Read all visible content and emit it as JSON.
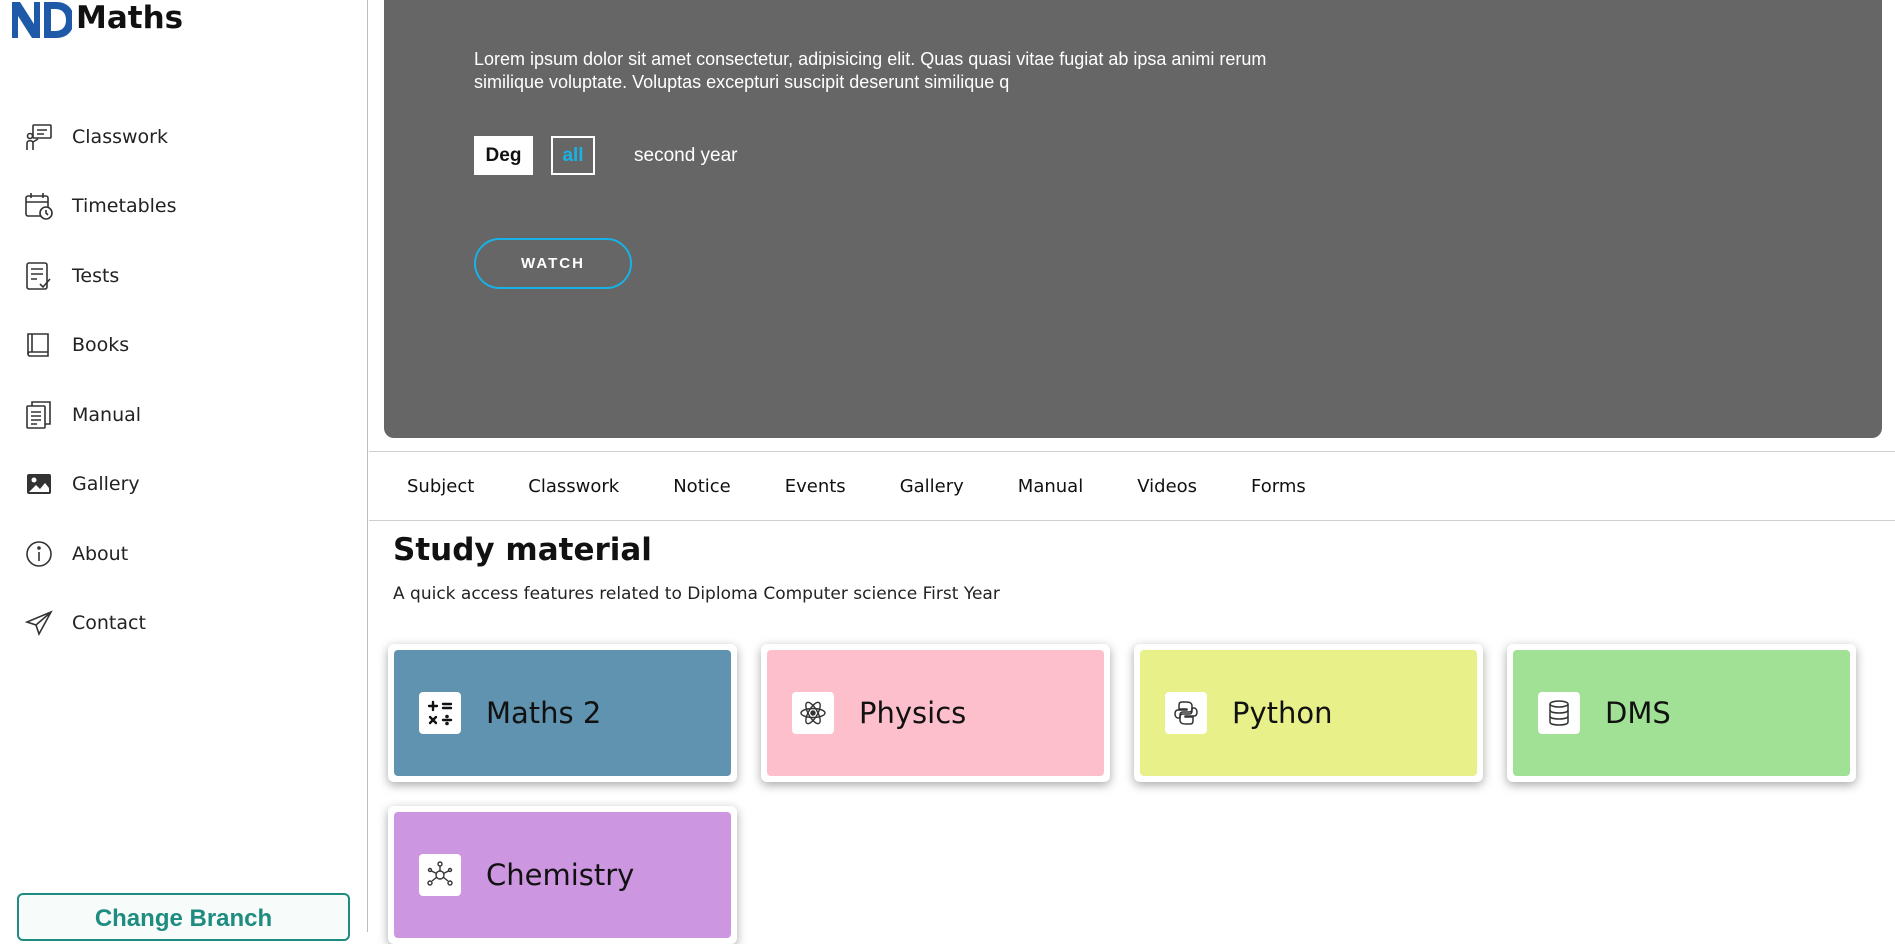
{
  "app": {
    "logo_text": "Maths"
  },
  "sidebar": {
    "items": [
      {
        "label": "Classwork",
        "icon": "classwork-icon"
      },
      {
        "label": "Timetables",
        "icon": "calendar-clock-icon"
      },
      {
        "label": "Tests",
        "icon": "test-checklist-icon"
      },
      {
        "label": "Books",
        "icon": "book-icon"
      },
      {
        "label": "Manual",
        "icon": "manual-document-icon"
      },
      {
        "label": "Gallery",
        "icon": "image-icon"
      },
      {
        "label": "About",
        "icon": "info-icon"
      },
      {
        "label": "Contact",
        "icon": "paper-plane-icon"
      }
    ],
    "change_branch_label": "Change Branch"
  },
  "hero": {
    "description": "Lorem ipsum dolor sit amet consectetur, adipisicing elit. Quas quasi vitae fugiat ab ipsa animi rerum similique voluptate. Voluptas excepturi suscipit deserunt similique q",
    "tag_primary": "Deg",
    "tag_secondary": "all",
    "year": "second year",
    "watch_label": "WATCH"
  },
  "tabs": [
    "Subject",
    "Classwork",
    "Notice",
    "Events",
    "Gallery",
    "Manual",
    "Videos",
    "Forms"
  ],
  "study": {
    "title": "Study material",
    "subtitle": "A quick access features related to Diploma Computer science First Year",
    "cards": [
      {
        "label": "Maths 2",
        "color": "#5f93b0",
        "icon": "calculator-icon"
      },
      {
        "label": "Physics",
        "color": "#fdbfcb",
        "icon": "atom-icon"
      },
      {
        "label": "Python",
        "color": "#e8f08a",
        "icon": "python-icon"
      },
      {
        "label": "DMS",
        "color": "#a0e195",
        "icon": "database-icon"
      },
      {
        "label": "Chemistry",
        "color": "#cd96e1",
        "icon": "molecule-icon"
      }
    ]
  },
  "colors": {
    "accent": "#17b3e6",
    "branch": "#1e8c80",
    "hero_bg": "#666666",
    "logo": "#1e5aa8"
  }
}
